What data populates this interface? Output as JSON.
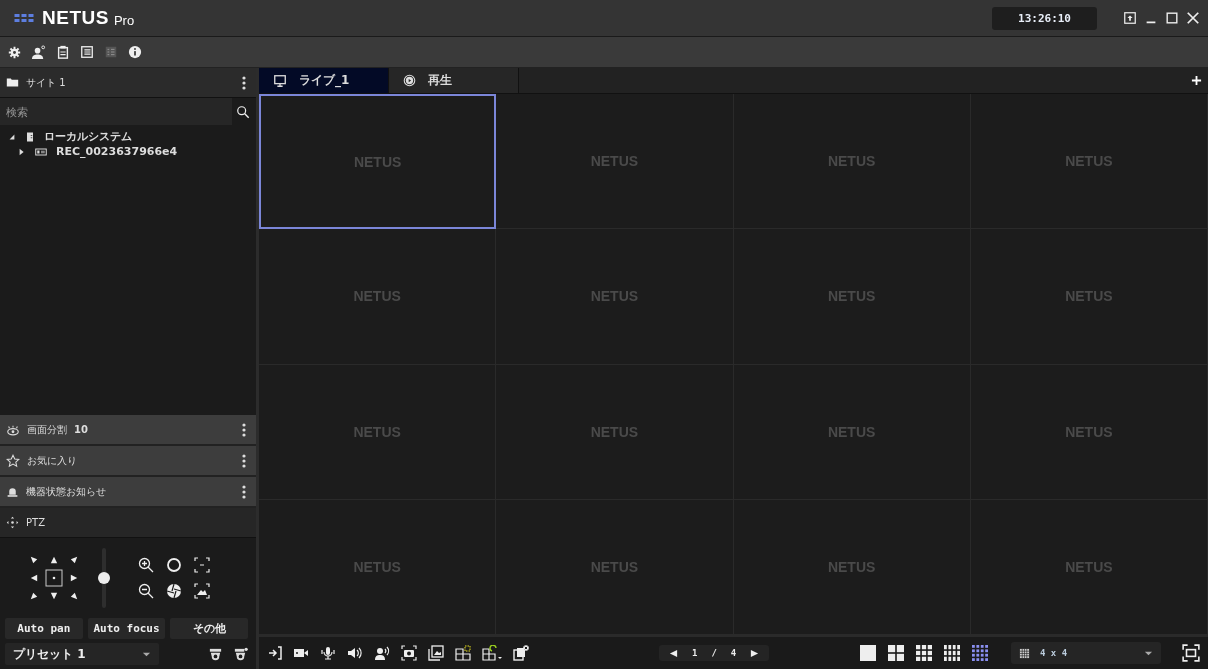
{
  "window": {
    "logo": "NETUS",
    "suffix": "Pro",
    "clock": "13:26:10"
  },
  "site": {
    "title": "サイト 1",
    "search": {
      "placeholder": "検索"
    },
    "tree": [
      {
        "label": "ローカルシステム",
        "kind": "system",
        "expanded": true,
        "children": [
          {
            "label": "REC_0023637966e4",
            "kind": "recorder",
            "expanded": false
          }
        ]
      }
    ]
  },
  "sections": [
    {
      "label": "画面分割",
      "count": "10",
      "kind": "eye"
    },
    {
      "label": "お気に入り",
      "kind": "star"
    },
    {
      "label": "機器状態お知らせ",
      "kind": "alarm"
    }
  ],
  "ptz": {
    "title": "PTZ",
    "zoom": {
      "level": 0.5
    },
    "buttons": [
      {
        "label": "Auto pan",
        "on": false
      },
      {
        "label": "Auto focus",
        "on": false
      },
      {
        "label": "その他",
        "on": false
      }
    ],
    "preset": "プリセット 1"
  },
  "tabs": [
    {
      "label": "ライブ_1",
      "kind": "live",
      "selected": true
    },
    {
      "label": "再生",
      "kind": "playback",
      "selected": false
    }
  ],
  "cells": [
    {
      "label": "NETUS",
      "selected": true
    },
    {
      "label": "NETUS",
      "selected": false
    },
    {
      "label": "NETUS",
      "selected": false
    },
    {
      "label": "NETUS",
      "selected": false
    },
    {
      "label": "NETUS",
      "selected": false
    },
    {
      "label": "NETUS",
      "selected": false
    },
    {
      "label": "NETUS",
      "selected": false
    },
    {
      "label": "NETUS",
      "selected": false
    },
    {
      "label": "NETUS",
      "selected": false
    },
    {
      "label": "NETUS",
      "selected": false
    },
    {
      "label": "NETUS",
      "selected": false
    },
    {
      "label": "NETUS",
      "selected": false
    },
    {
      "label": "NETUS",
      "selected": false
    },
    {
      "label": "NETUS",
      "selected": false
    },
    {
      "label": "NETUS",
      "selected": false
    },
    {
      "label": "NETUS",
      "selected": false
    }
  ],
  "pager": {
    "current": "1",
    "separator": "/",
    "total": "4"
  },
  "layouts": [
    {
      "kind": "single",
      "selected": false
    },
    {
      "kind": "quad",
      "selected": false
    },
    {
      "kind": "nine",
      "selected": false
    },
    {
      "kind": "twelve",
      "selected": false
    },
    {
      "kind": "sixteen",
      "selected": true
    }
  ],
  "layout_select": "4 x 4"
}
